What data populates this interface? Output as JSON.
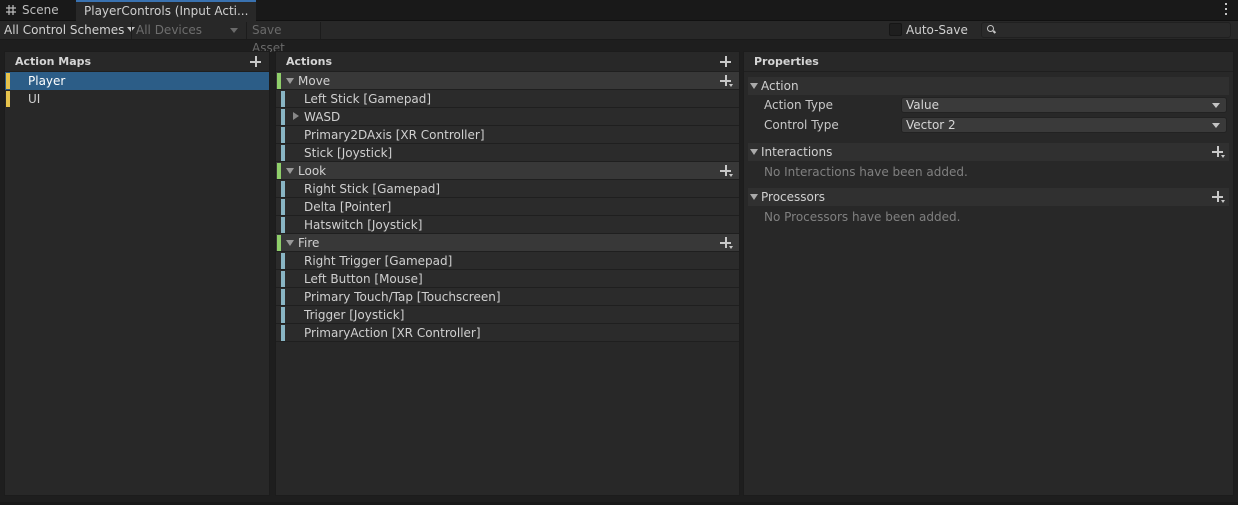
{
  "tabs": [
    {
      "label": "Scene",
      "icon": "scene-grid-icon"
    },
    {
      "label": "PlayerControls (Input Acti..."
    }
  ],
  "toolbar": {
    "control_schemes": "All Control Schemes",
    "devices": "All Devices",
    "save_asset": "Save Asset",
    "auto_save": "Auto-Save",
    "search_value": ""
  },
  "action_maps": {
    "header": "Action Maps",
    "items": [
      {
        "label": "Player",
        "selected": true
      },
      {
        "label": "UI",
        "selected": false
      }
    ]
  },
  "actions": {
    "header": "Actions",
    "groups": [
      {
        "label": "Move",
        "bindings": [
          "Left Stick [Gamepad]",
          "WASD",
          "Primary2DAxis [XR Controller]",
          "Stick [Joystick]"
        ]
      },
      {
        "label": "Look",
        "bindings": [
          "Right Stick [Gamepad]",
          "Delta [Pointer]",
          "Hatswitch [Joystick]"
        ]
      },
      {
        "label": "Fire",
        "bindings": [
          "Right Trigger [Gamepad]",
          "Left Button [Mouse]",
          "Primary Touch/Tap [Touchscreen]",
          "Trigger [Joystick]",
          "PrimaryAction [XR Controller]"
        ]
      }
    ]
  },
  "properties": {
    "header": "Properties",
    "action_section": "Action",
    "action_type_label": "Action Type",
    "action_type_value": "Value",
    "control_type_label": "Control Type",
    "control_type_value": "Vector 2",
    "interactions_section": "Interactions",
    "interactions_empty": "No Interactions have been added.",
    "processors_section": "Processors",
    "processors_empty": "No Processors have been added."
  },
  "colors": {
    "selected_row": "#2c5d87",
    "map_stripe": "#e6c34c",
    "action_stripe": "#8fcf6a",
    "binding_stripe": "#89b5c4"
  }
}
